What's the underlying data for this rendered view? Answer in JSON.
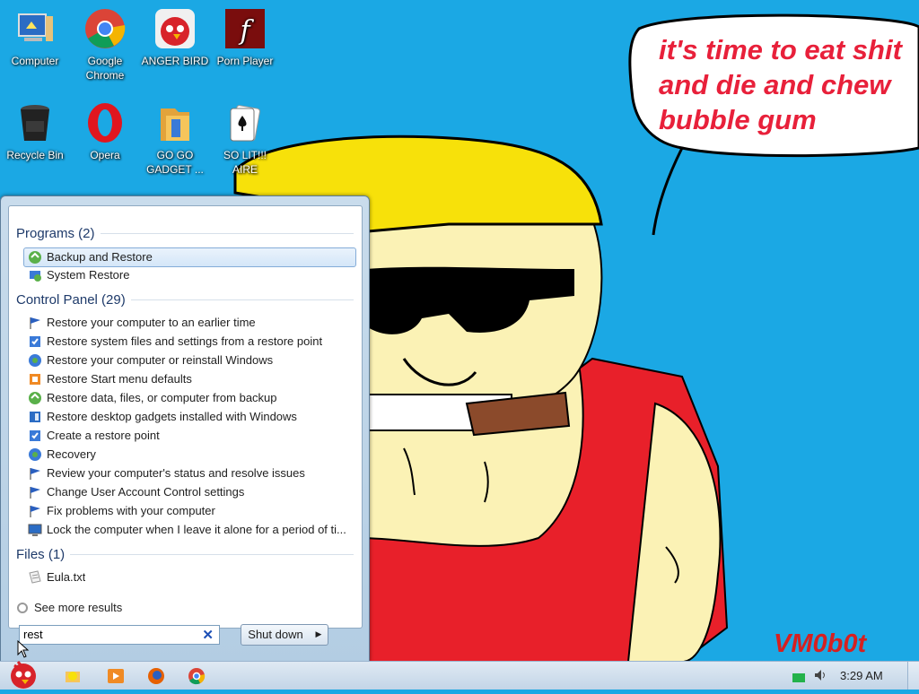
{
  "wallpaper": {
    "speech_lines": [
      "it's time to eat shit",
      "and die and chew",
      "bubble gum"
    ],
    "signature": "VM0b0t"
  },
  "desktop_icons": [
    {
      "label": "Computer",
      "icon": "computer-icon"
    },
    {
      "label": "Google Chrome",
      "icon": "chrome-icon"
    },
    {
      "label": "ANGER BIRD",
      "icon": "angry-bird-icon"
    },
    {
      "label": "Porn Player",
      "icon": "flash-player-icon"
    },
    {
      "label": "Recycle Bin",
      "icon": "recycle-bin-icon"
    },
    {
      "label": "Opera",
      "icon": "opera-icon"
    },
    {
      "label": "GO GO GADGET ...",
      "icon": "folder-icon"
    },
    {
      "label": "SO LIT!!! AIRE",
      "icon": "solitaire-icon"
    }
  ],
  "start_menu": {
    "groups": {
      "programs": "Programs (2)",
      "control_panel": "Control Panel (29)",
      "files": "Files (1)"
    },
    "programs": [
      "Backup and Restore",
      "System Restore"
    ],
    "control_panel": [
      "Restore your computer to an earlier time",
      "Restore system files and settings from a restore point",
      "Restore your computer or reinstall Windows",
      "Restore Start menu defaults",
      "Restore data, files, or computer from backup",
      "Restore desktop gadgets installed with Windows",
      "Create a restore point",
      "Recovery",
      "Review your computer's status and resolve issues",
      "Change User Account Control settings",
      "Fix problems with your computer",
      "Lock the computer when I leave it alone for a period of ti..."
    ],
    "files": [
      "Eula.txt"
    ],
    "see_more": "See more results",
    "search_value": "rest",
    "shutdown_label": "Shut down"
  },
  "taskbar": {
    "clock": "3:29 AM"
  },
  "colors": {
    "desktop_bg": "#1ba8e4",
    "speech_text": "#e8203a",
    "shirt": "#e8202a",
    "hair": "#f7e10a",
    "skin": "#fbf2b5"
  }
}
